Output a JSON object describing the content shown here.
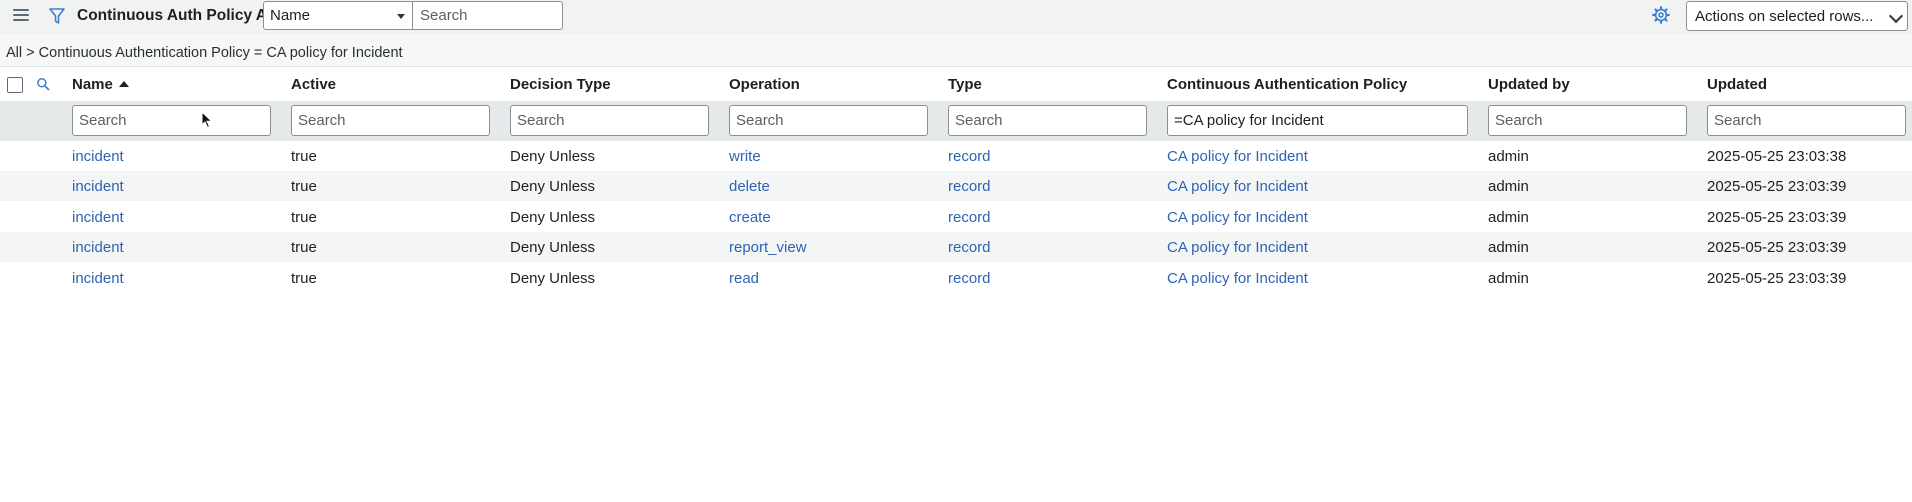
{
  "header": {
    "title": "Continuous Auth Policy ACLs",
    "field_select": "Name",
    "search_placeholder": "Search",
    "actions_label": "Actions on selected rows..."
  },
  "breadcrumb": {
    "all": "All",
    "separator": ">",
    "condition": "Continuous Authentication Policy = CA policy for Incident"
  },
  "columns": [
    {
      "label": "Name",
      "search_placeholder": "Search",
      "search_value": ""
    },
    {
      "label": "Active",
      "search_placeholder": "Search",
      "search_value": ""
    },
    {
      "label": "Decision Type",
      "search_placeholder": "Search",
      "search_value": ""
    },
    {
      "label": "Operation",
      "search_placeholder": "Search",
      "search_value": ""
    },
    {
      "label": "Type",
      "search_placeholder": "Search",
      "search_value": ""
    },
    {
      "label": "Continuous Authentication Policy",
      "search_placeholder": "Search",
      "search_value": "=CA policy for Incident"
    },
    {
      "label": "Updated by",
      "search_placeholder": "Search",
      "search_value": ""
    },
    {
      "label": "Updated",
      "search_placeholder": "Search",
      "search_value": ""
    }
  ],
  "rows": [
    {
      "name": "incident",
      "active": "true",
      "decision_type": "Deny Unless",
      "operation": "write",
      "type": "record",
      "policy": "CA policy for Incident",
      "updated_by": "admin",
      "updated": "2025-05-25 23:03:38"
    },
    {
      "name": "incident",
      "active": "true",
      "decision_type": "Deny Unless",
      "operation": "delete",
      "type": "record",
      "policy": "CA policy for Incident",
      "updated_by": "admin",
      "updated": "2025-05-25 23:03:39"
    },
    {
      "name": "incident",
      "active": "true",
      "decision_type": "Deny Unless",
      "operation": "create",
      "type": "record",
      "policy": "CA policy for Incident",
      "updated_by": "admin",
      "updated": "2025-05-25 23:03:39"
    },
    {
      "name": "incident",
      "active": "true",
      "decision_type": "Deny Unless",
      "operation": "report_view",
      "type": "record",
      "policy": "CA policy for Incident",
      "updated_by": "admin",
      "updated": "2025-05-25 23:03:39"
    },
    {
      "name": "incident",
      "active": "true",
      "decision_type": "Deny Unless",
      "operation": "read",
      "type": "record",
      "policy": "CA policy for Incident",
      "updated_by": "admin",
      "updated": "2025-05-25 23:03:39"
    }
  ],
  "sort": {
    "column": "Name",
    "direction": "ascending"
  },
  "colors": {
    "link": "#2d63b5",
    "icon_accent": "#3a7fd5",
    "header_bg": "#f1f3f3",
    "search_row_bg": "#e6e9e9"
  },
  "icons": [
    "hamburger-menu-icon",
    "filter-icon",
    "gear-icon",
    "search-icon",
    "sort-ascending-icon",
    "mouse-cursor-icon"
  ]
}
